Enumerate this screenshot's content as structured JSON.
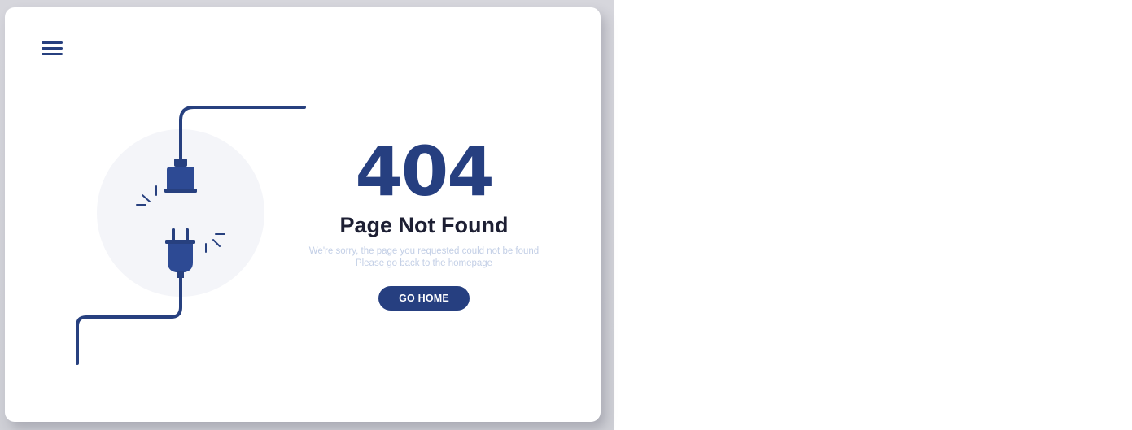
{
  "error": {
    "code": "404",
    "title": "Page Not Found",
    "message_line1": "We're sorry, the page you requested could not be found",
    "message_line2": "Please go back to the homepage",
    "button_label": "GO HOME"
  },
  "icons": {
    "menu": "hamburger-menu-icon",
    "illustration": "unplugged-cable-icon"
  },
  "colors": {
    "primary": "#263f80",
    "title": "#1d1f33",
    "message": "#c3cfe6",
    "circle": "#f4f5f9",
    "backdrop": "#d3d3d9",
    "card": "#ffffff"
  }
}
